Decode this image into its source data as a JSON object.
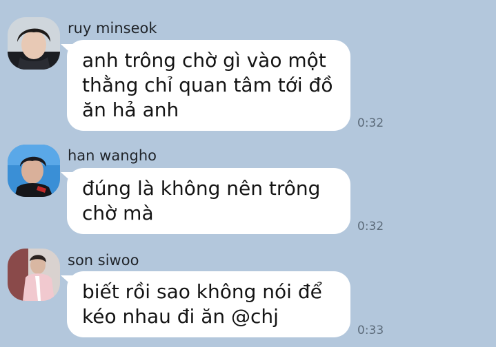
{
  "messages": [
    {
      "sender": "ruy minseok",
      "lines": [
        "anh trông chờ gì vào một",
        "thằng chỉ quan tâm tới đồ",
        "ăn hả anh"
      ],
      "time": "0:32"
    },
    {
      "sender": "han wangho",
      "lines": [
        "đúng là không nên trông",
        "chờ mà"
      ],
      "time": "0:32"
    },
    {
      "sender": "son siwoo",
      "lines": [
        "biết rồi sao không nói để",
        "kéo nhau đi ăn @chj"
      ],
      "time": "0:33"
    }
  ],
  "colors": {
    "background": "#b3c7dc",
    "bubble": "#ffffff",
    "time_text": "#5c6b7a"
  }
}
